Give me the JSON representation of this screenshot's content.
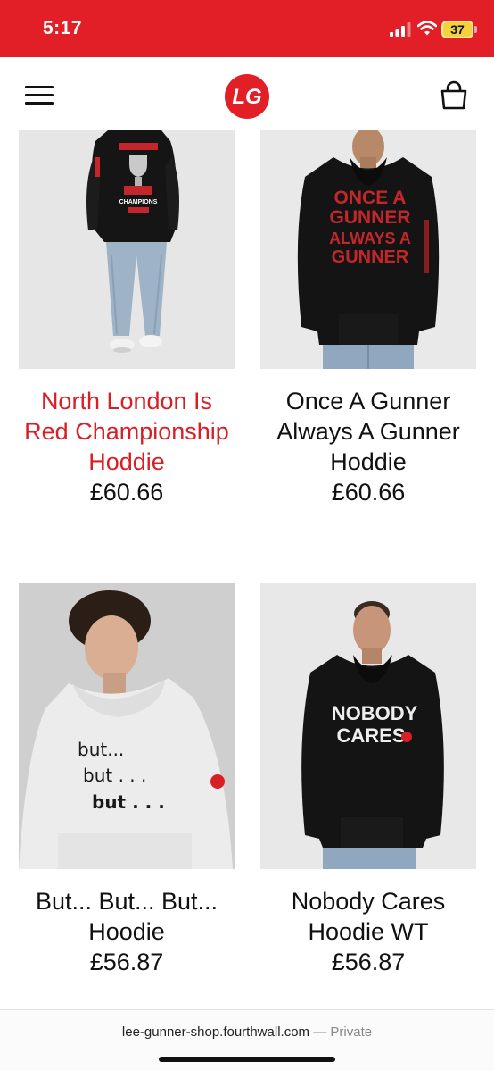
{
  "status_bar": {
    "time": "5:17",
    "battery": "37",
    "background_color": "#e21f26"
  },
  "header": {
    "menu_icon": "hamburger-menu-icon",
    "logo_text": "LG",
    "cart_icon": "shopping-bag-icon"
  },
  "products": [
    {
      "title": "North London Is Red Championship Hoddie",
      "price": "£60.66",
      "title_color": "#d81f26",
      "image": "black hoodie with trophy back print",
      "print_text": "CHAMPIONS"
    },
    {
      "title": "Once A Gunner Always A Gunner Hoddie",
      "price": "£60.66",
      "image": "black hoodie with red text",
      "print_lines": [
        "ONCE A",
        "GUNNER",
        "ALWAYS A",
        "GUNNER"
      ]
    },
    {
      "title": "But... But... But... Hoodie",
      "price": "£56.87",
      "image": "grey hoodie with text",
      "print_lines": [
        "but...",
        "but . . .",
        "but . . ."
      ]
    },
    {
      "title": "Nobody Cares Hoodie WT",
      "price": "£56.87",
      "image": "black hoodie with white text",
      "print_lines": [
        "NOBODY",
        "CARES"
      ]
    }
  ],
  "url_bar": {
    "domain": "lee-gunner-shop.fourthwall.com",
    "separator": " — ",
    "mode": "Private"
  }
}
